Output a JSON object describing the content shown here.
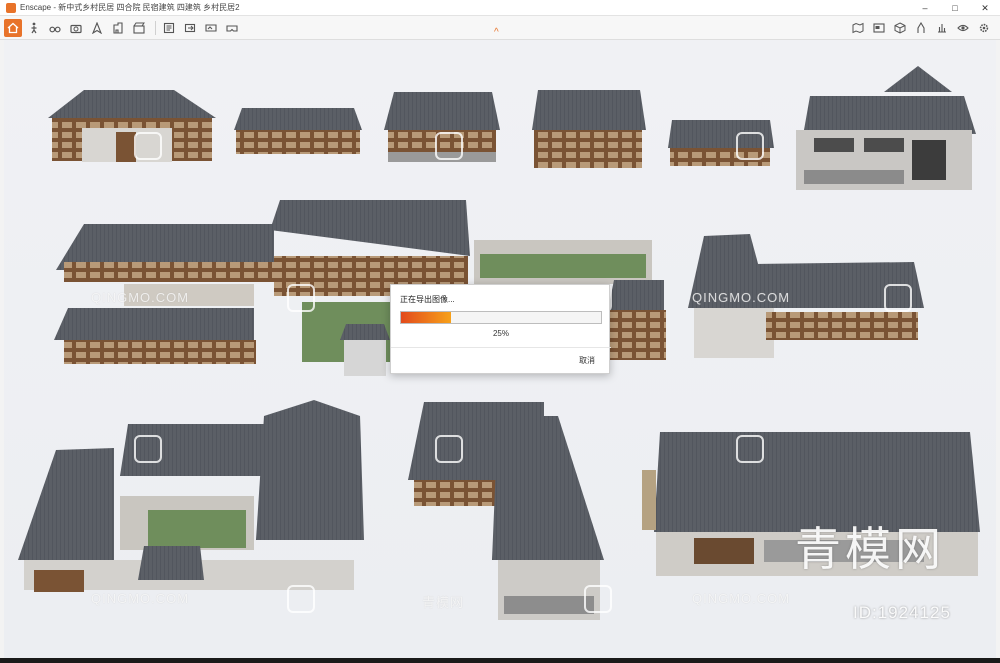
{
  "window": {
    "title": "Enscape - 新中式乡村民居 四合院 民宿建筑 四建筑 乡村民居2",
    "minimize": "–",
    "maximize": "□",
    "close": "✕"
  },
  "toolbar": {
    "left_icons": [
      "home-icon",
      "walk-icon",
      "binoculars-icon",
      "camera-icon",
      "compass-icon",
      "screenshot-icon",
      "video-icon",
      "batch-render-icon",
      "export-icon",
      "panorama-icon",
      "vr-icon"
    ],
    "right_icons": [
      "map-icon",
      "window-icon",
      "cube-icon",
      "asset-library-icon",
      "light-icon",
      "view-icon",
      "settings-icon"
    ],
    "collapse": "^"
  },
  "dialog": {
    "title": "正在导出图像...",
    "percent": "25%",
    "progress": 0.25,
    "cancel": "取消"
  },
  "watermarks": {
    "site": "QINGMO.COM",
    "cn": "青模网",
    "brand": "青模网",
    "id": "ID:1924125"
  },
  "colors": {
    "accent": "#e8732a",
    "roof": "#565a60",
    "wall": "#e9e6e0",
    "wood": "#7a5334",
    "grass": "#6f8e5c"
  }
}
